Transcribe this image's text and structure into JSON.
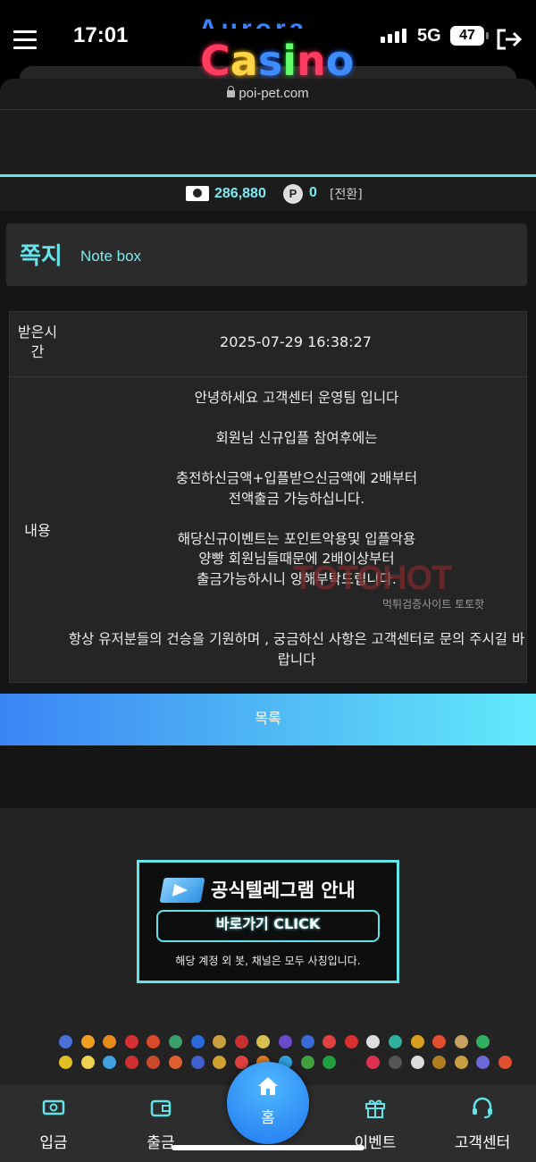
{
  "status_bar": {
    "time": "17:01",
    "network": "5G",
    "battery": "47"
  },
  "browser": {
    "url": "poi-pet.com"
  },
  "header": {
    "logo_top": "Aurora",
    "logo_letters": [
      "C",
      "a",
      "s",
      "i",
      "n",
      "o"
    ]
  },
  "balance": {
    "money": "286,880",
    "point_badge": "P",
    "points": "0",
    "convert_label": "[전환]"
  },
  "note": {
    "title": "쪽지",
    "subtitle": "Note box"
  },
  "message": {
    "received_label": "받은시간",
    "received_value": "2025-07-29 16:38:27",
    "content_label": "내용",
    "lines": [
      "안녕하세요 고객센터 운영팀 입니다",
      "",
      "회원님 신규입플 참여후에는",
      "",
      "충전하신금액+입플받으신금액에 2배부터",
      "전액출금 가능하십니다.",
      "",
      "해당신규이벤트는 포인트악용및 입플악용",
      "양빵 회원님들때문에 2배이상부터",
      "출금가능하시니 양해부탁드립니다.",
      "",
      "",
      "항상 유저분들의 건승을 기원하며 , 궁금하신 사항은 고객센터로 문의 주시길 바랍니다"
    ]
  },
  "watermark": {
    "main": "TOTOHOT",
    "sub": "먹튀검증사이트 토토핫"
  },
  "list_button": {
    "label": "목록"
  },
  "telegram_banner": {
    "title": "공식텔레그램 안내",
    "cta": "바로가기 CLICK",
    "note": "해당 계정 외 봇, 채널은 모두 사칭입니다."
  },
  "providers": {
    "row1": [
      "#4a6fd6",
      "#f0a020",
      "#e88a1a",
      "#d83030",
      "#d84a2a",
      "#3aa06a",
      "#2a6ad8",
      "#c8a040",
      "#c83030",
      "#d8c050",
      "#6a4ac8",
      "#3a6ad8",
      "#e04040",
      "#d83030",
      "#dddddd",
      "#30b0a0",
      "#d8a020",
      "#e05030",
      "#c8a060",
      "#30b060"
    ],
    "row2": [
      "#e0c020",
      "#f0d050",
      "#40a0e0",
      "#d03030",
      "#c84a2a",
      "#e06030",
      "#4060d0",
      "#d0a030",
      "#e04040",
      "#e08020",
      "#30a0e0",
      "#40a040",
      "#20a040",
      "#222222",
      "#e03050",
      "#555555",
      "#dddddd",
      "#b08020",
      "#c8a040",
      "#6a6ad8",
      "#e05030"
    ]
  },
  "bottom_nav": {
    "deposit": "입금",
    "withdraw": "출금",
    "home": "홈",
    "event": "이벤트",
    "support": "고객센터"
  },
  "colors": {
    "accent": "#63e4ea",
    "button_start": "#3b84f5",
    "button_end": "#63eafc"
  }
}
